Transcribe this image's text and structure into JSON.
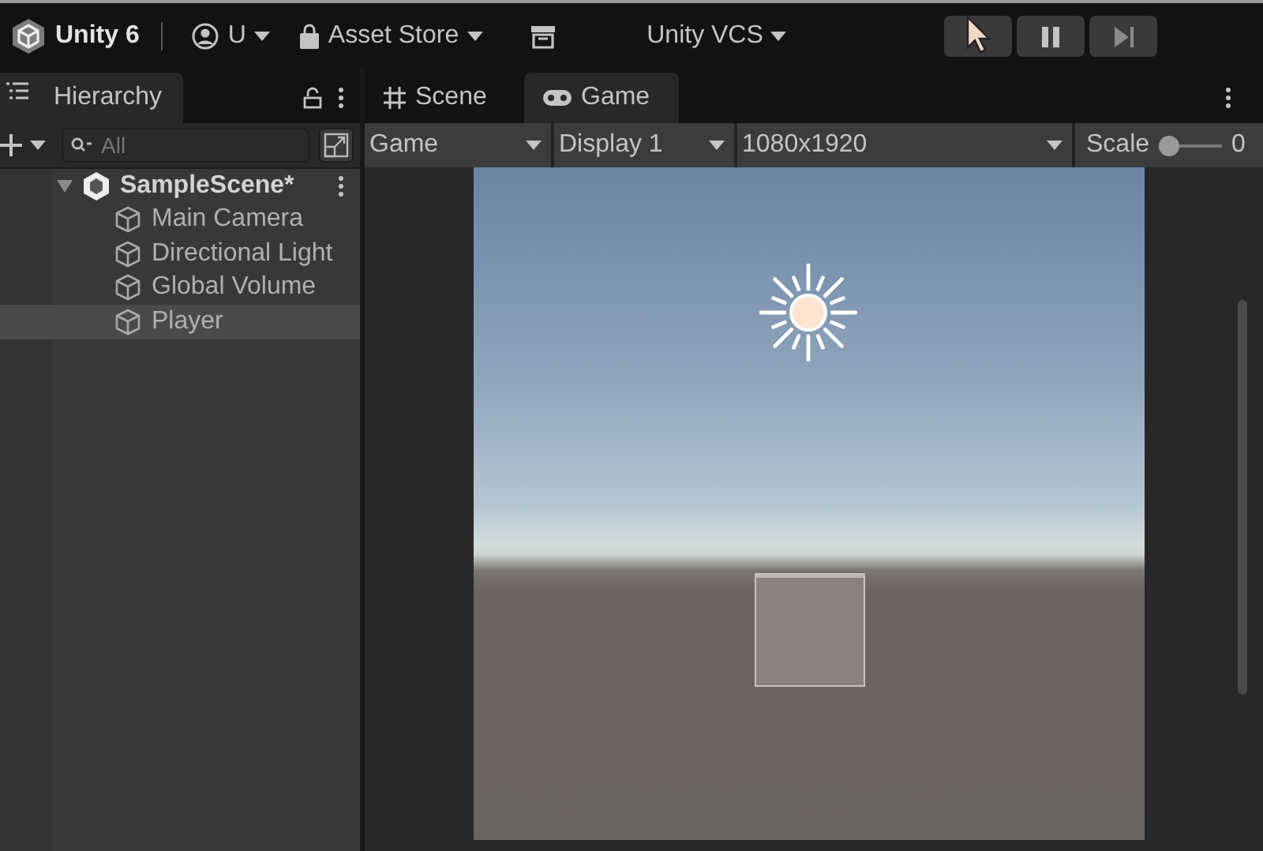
{
  "toolbar": {
    "product": "Unity 6",
    "account": "U",
    "asset_store": "Asset Store",
    "vcs": "Unity VCS",
    "play_controls": [
      {
        "kind": "play"
      },
      {
        "kind": "pause"
      },
      {
        "kind": "step"
      }
    ]
  },
  "hierarchy": {
    "tab": {
      "label": "Hierarchy",
      "selected": true
    },
    "search": {
      "placeholder": "All"
    },
    "tree": [
      {
        "label": "SampleScene*",
        "kind": "scene",
        "expanded": true,
        "selected": false,
        "children": [
          {
            "label": "Main Camera",
            "kind": "object",
            "selected": false
          },
          {
            "label": "Directional Light",
            "kind": "object",
            "selected": false
          },
          {
            "label": "Global Volume",
            "kind": "object",
            "selected": false
          },
          {
            "label": "Player",
            "kind": "object",
            "selected": true
          }
        ]
      }
    ]
  },
  "view": {
    "tabs": [
      {
        "label": "Scene",
        "kind": "scene",
        "selected": false
      },
      {
        "label": "Game",
        "kind": "game",
        "selected": true
      }
    ],
    "mode": "Game",
    "display": "Display 1",
    "resolution": "1080x1920",
    "scale": {
      "label": "Scale",
      "level": 0.15,
      "reading": "0"
    }
  }
}
